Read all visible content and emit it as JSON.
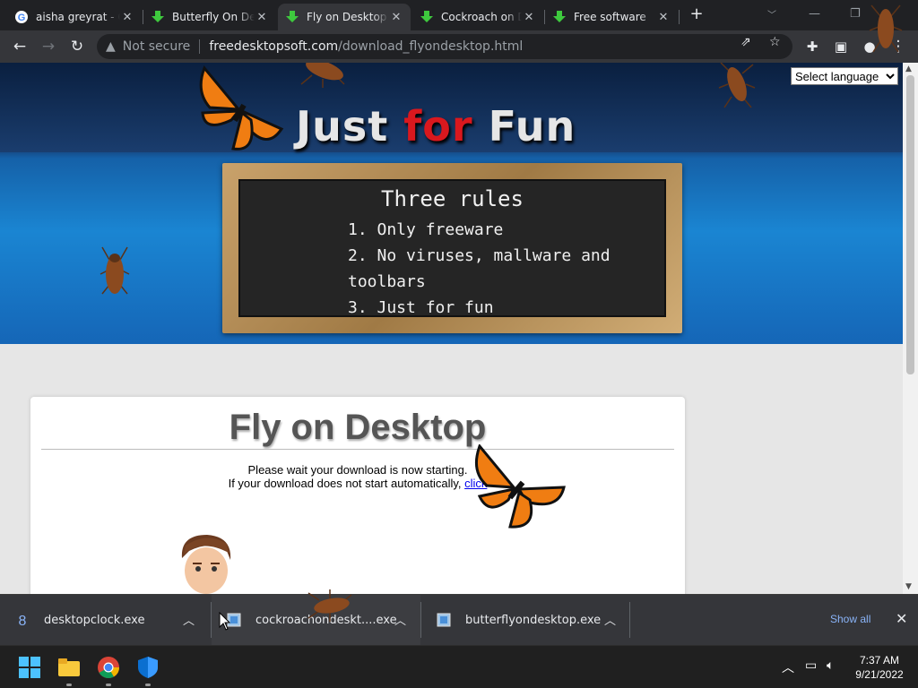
{
  "browser": {
    "tabs": [
      {
        "title": "aisha greyrat - Google",
        "favicon": "google-icon",
        "active": false
      },
      {
        "title": "Butterfly On Desktop",
        "favicon": "download-arrow-icon",
        "active": false
      },
      {
        "title": "Fly on Desktop",
        "favicon": "download-arrow-icon",
        "active": true
      },
      {
        "title": "Cockroach on Desktop",
        "favicon": "download-arrow-icon",
        "active": false
      },
      {
        "title": "Free software",
        "favicon": "download-arrow-icon",
        "active": false
      }
    ],
    "address": {
      "security": "Not secure",
      "host": "freedesktopsoft.com",
      "path": "/download_flyondesktop.html"
    }
  },
  "page": {
    "language_select": "Select language",
    "headline": {
      "w1": "Just",
      "w2": "for",
      "w3": "Fun"
    },
    "rules": {
      "title": "Three rules",
      "items": [
        "1. Only freeware",
        "2. No viruses, mallware and toolbars",
        "3. Just for fun"
      ]
    },
    "card": {
      "title": "Fly on Desktop",
      "line1": "Please wait your download is now starting.",
      "line2": "If your download does not start automatically,",
      "link": "click"
    }
  },
  "downloads": {
    "items": [
      {
        "name": "desktopclock.exe",
        "icon": "clock-app-icon"
      },
      {
        "name": "cockroachondeskt....exe",
        "icon": "installer-icon"
      },
      {
        "name": "butterflyondesktop.exe",
        "icon": "installer-icon"
      }
    ],
    "show_all": "Show all"
  },
  "taskbar": {
    "time": "7:37 AM",
    "date": "9/21/2022"
  },
  "colors": {
    "accent_link": "#8ab4f8",
    "headline_red": "#d9181e",
    "banner_blue": "#1a85d2"
  }
}
